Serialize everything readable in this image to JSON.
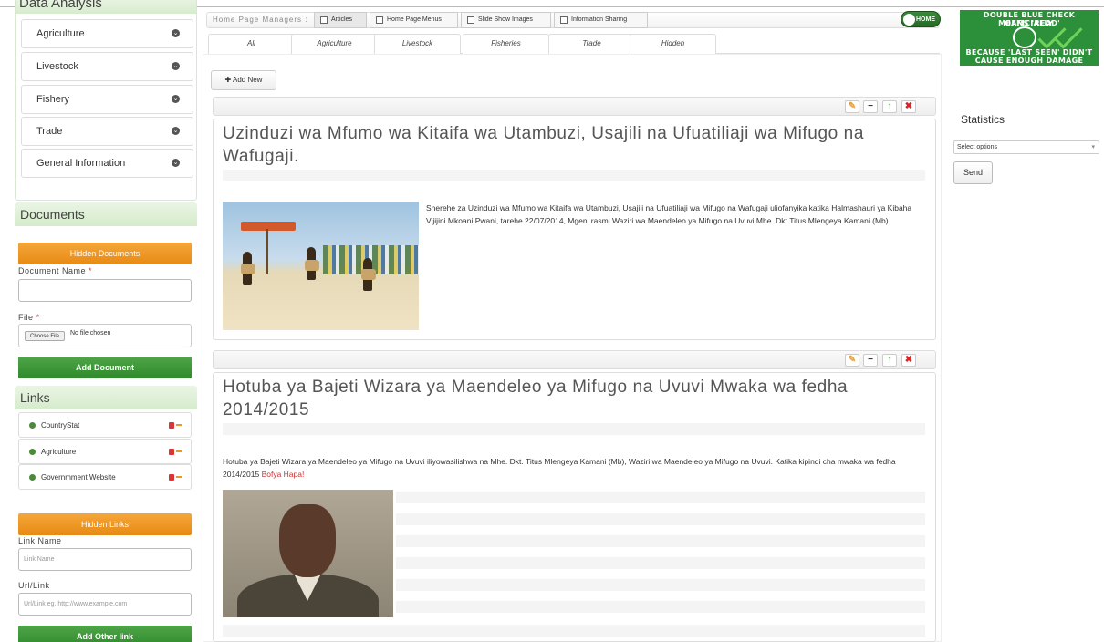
{
  "sidebar": {
    "data_analysis": {
      "title": "Data Analysis",
      "items": [
        {
          "label": "Agriculture"
        },
        {
          "label": "Livestock"
        },
        {
          "label": "Fishery"
        },
        {
          "label": "Trade"
        },
        {
          "label": "General Information"
        }
      ]
    },
    "documents": {
      "title": "Documents",
      "hidden_button": "Hidden Documents",
      "doc_name_label": "Document Name",
      "file_label": "File",
      "required_mark": "*",
      "choose_file": "Choose File",
      "no_file": "No file chosen",
      "add_button": "Add Document"
    },
    "links": {
      "title": "Links",
      "items": [
        {
          "label": "CountryStat"
        },
        {
          "label": "Agriculture"
        },
        {
          "label": "Governmment Website"
        }
      ],
      "hidden_button": "Hidden Links",
      "link_name_label": "Link Name",
      "link_name_placeholder": "Link Name",
      "url_label": "Url/Link",
      "url_placeholder": "Url/Link eg. http://www.example.com",
      "add_button": "Add Other link"
    }
  },
  "toolbar": {
    "label": "Home Page Managers :",
    "tabs": [
      {
        "label": "Articles"
      },
      {
        "label": "Home Page Menus"
      },
      {
        "label": "Slide Show Images"
      },
      {
        "label": "Information Sharing"
      }
    ],
    "home_toggle": "HOME"
  },
  "category_tabs": [
    "All",
    "Agriculture",
    "Livestock",
    "Fisheries",
    "Trade",
    "Hidden"
  ],
  "add_new": "Add New",
  "articles": [
    {
      "title": "Uzinduzi wa Mfumo wa Kitaifa wa Utambuzi, Usajili na Ufuatiliaji wa Mifugo na Wafugaji.",
      "body": "Sherehe za Uzinduzi wa Mfumo wa Kitaifa wa Utambuzi, Usajili na Ufuatiliaji wa Mifugo na Wafugaji uliofanyika katika Halmashauri ya Kibaha Vijijini Mkoani Pwani, tarehe 22/07/2014, Mgeni rasmi Waziri wa Maendeleo ya Mifugo na Uvuvi Mhe. Dkt.Titus Mlengeya Kamani (Mb)"
    },
    {
      "title": "Hotuba ya Bajeti Wizara ya Maendeleo ya Mifugo na Uvuvi Mwaka wa fedha 2014/2015",
      "body": "Hotuba ya  Bajeti  Wizara ya Maendeleo ya Mifugo na Uvuvi  iliyowasilishwa  na Mhe. Dkt. Titus Mlengeya Kamani (Mb), Waziri wa Maendeleo ya Mifugo na Uvuvi. Katika kipindi cha mwaka wa fedha 2014/2015",
      "link": "Bofya Hapa!"
    }
  ],
  "ad": {
    "line1": "DOUBLE BLUE CHECK OFFICIALLY",
    "line2": "MEANS 'READ'",
    "line3": "BECAUSE 'LAST SEEN' DIDN'T",
    "line4": "CAUSE ENOUGH DAMAGE"
  },
  "statistics": {
    "title": "Statistics",
    "select_value": "Select options",
    "send": "Send"
  },
  "colors": {
    "accent_green": "#2e8a2a",
    "accent_orange": "#e78a14",
    "panel_green": "#d7ecce"
  }
}
